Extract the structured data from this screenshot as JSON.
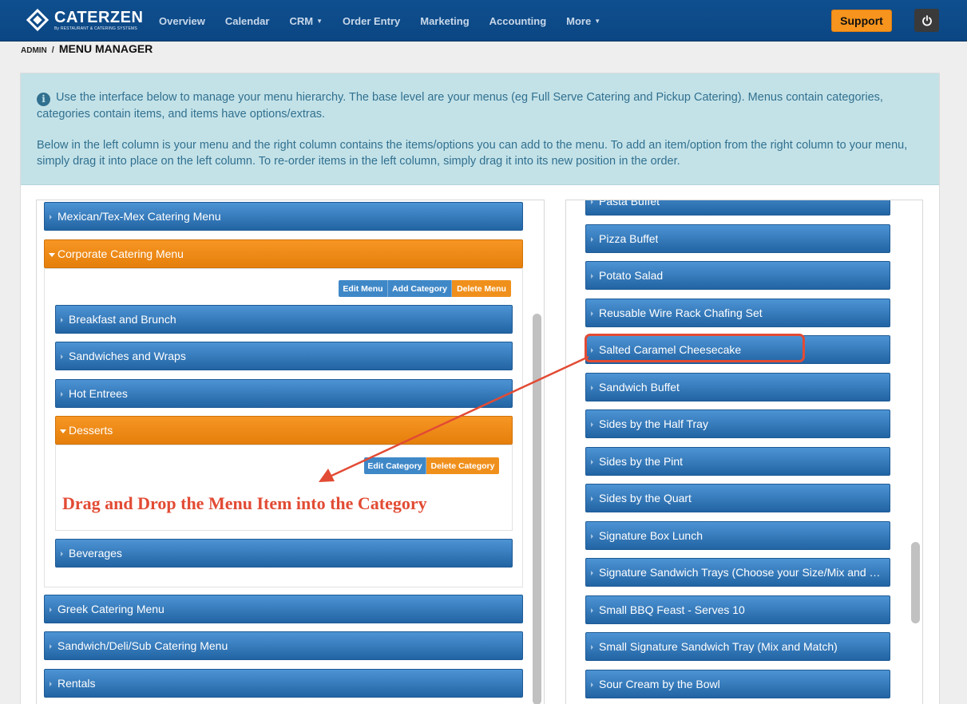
{
  "app": {
    "logo_name": "CATERZEN",
    "logo_sub": "By RESTAURANT & CATERING SYSTEMS"
  },
  "nav": {
    "items": [
      {
        "label": "Overview",
        "dropdown": false
      },
      {
        "label": "Calendar",
        "dropdown": false
      },
      {
        "label": "CRM",
        "dropdown": true
      },
      {
        "label": "Order Entry",
        "dropdown": false
      },
      {
        "label": "Marketing",
        "dropdown": false
      },
      {
        "label": "Accounting",
        "dropdown": false
      },
      {
        "label": "More",
        "dropdown": true
      }
    ],
    "support_label": "Support"
  },
  "breadcrumb": {
    "root": "ADMIN",
    "separator": "/",
    "current": "MENU MANAGER"
  },
  "info": {
    "paragraph1": "Use the interface below to manage your menu hierarchy. The base level are your menus (eg Full Serve Catering and Pickup Catering). Menus contain categories, categories contain items, and items have options/extras.",
    "paragraph2": "Below in the left column is your menu and the right column contains the items/options you can add to the menu. To add an item/option from the right column to your menu, simply drag it into place on the left column. To re-order items in the left column, simply drag it into its new position in the order."
  },
  "menu_tree": {
    "menus": [
      "Mexican/Tex-Mex Catering Menu",
      "Corporate Catering Menu",
      "Greek Catering Menu",
      "Sandwich/Deli/Sub Catering Menu",
      "Rentals"
    ],
    "menu_buttons": {
      "edit": "Edit Menu",
      "add_category": "Add Category",
      "delete": "Delete Menu"
    },
    "categories": [
      "Breakfast and Brunch",
      "Sandwiches and Wraps",
      "Hot Entrees",
      "Desserts",
      "Beverages"
    ],
    "category_buttons": {
      "edit": "Edit Category",
      "delete": "Delete Category"
    },
    "expanded_menu": "Corporate Catering Menu",
    "expanded_category": "Desserts"
  },
  "annotation": {
    "text": "Drag and Drop the Menu Item into the Category",
    "color": "#e24b34"
  },
  "items": {
    "list": [
      "Pasta Buffet",
      "Pizza Buffet",
      "Potato Salad",
      "Reusable Wire Rack Chafing Set",
      "Salted Caramel Cheesecake",
      "Sandwich Buffet",
      "Sides by the Half Tray",
      "Sides by the Pint",
      "Sides by the Quart",
      "Signature Box Lunch",
      "Signature Sandwich Trays (Choose your Size/Mix and Match)",
      "Small BBQ Feast - Serves 10",
      "Small Signature Sandwich Tray (Mix and Match)",
      "Sour Cream by the Bowl"
    ],
    "highlighted": "Salted Caramel Cheesecake"
  },
  "colors": {
    "nav_bg": "#0b4683",
    "bar_blue": "#2264a4",
    "bar_orange": "#f7941d",
    "info_bg": "#c3e2e8",
    "accent_red": "#e24b34"
  }
}
